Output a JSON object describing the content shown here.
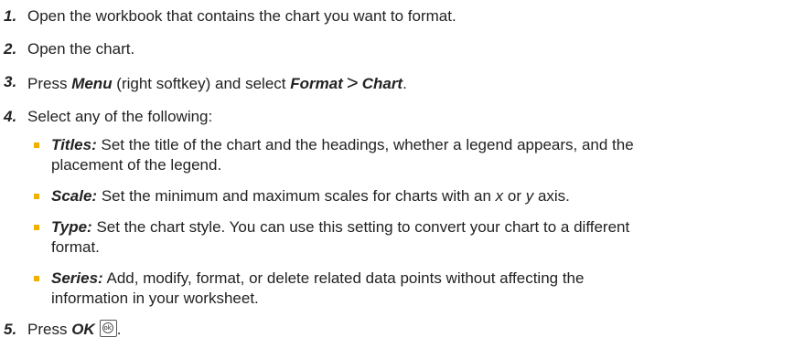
{
  "steps": [
    {
      "num": "1.",
      "text": "Open the workbook that contains the chart you want to format."
    },
    {
      "num": "2.",
      "text": "Open the chart."
    },
    {
      "num": "3.",
      "pre": "Press ",
      "menu": "Menu",
      "mid": " (right softkey) and select ",
      "format": "Format",
      "gt": ">",
      "chart": "Chart",
      "post": "."
    },
    {
      "num": "4.",
      "text": "Select any of the following:"
    },
    {
      "num": "5.",
      "pre": "Press ",
      "ok": "OK",
      "post": "."
    }
  ],
  "options": [
    {
      "name": "Titles:",
      "lines": [
        "Set the title of the chart and the headings, whether a legend appears, and the",
        "placement of the legend."
      ]
    },
    {
      "name": "Scale:",
      "pre": "Set the minimum and maximum scales for charts with an ",
      "x": "x",
      "or": " or ",
      "y": "y",
      "post": " axis."
    },
    {
      "name": "Type:",
      "lines": [
        "Set the chart style. You can use this setting to convert your chart to a different",
        "format."
      ]
    },
    {
      "name": "Series:",
      "lines": [
        "Add, modify, format, or delete related data points without affecting the",
        "information in your worksheet."
      ]
    }
  ],
  "ok_key_icon": "ok-key-icon",
  "ok_key_glyph": "ok",
  "colors": {
    "bullet": "#f0b000",
    "text": "#222222"
  }
}
